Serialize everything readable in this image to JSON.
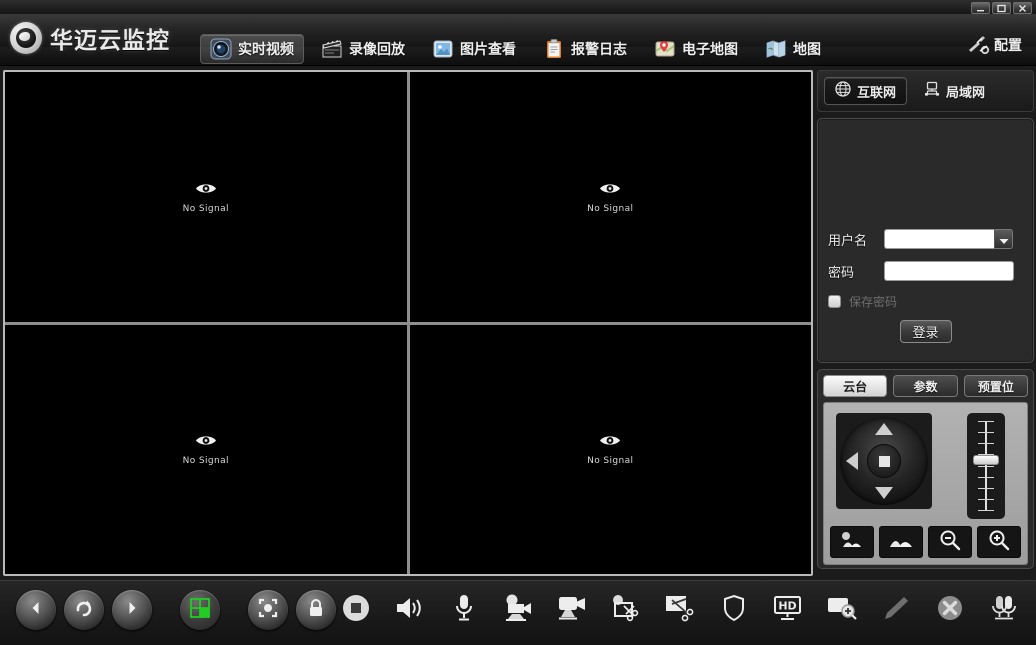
{
  "window": {
    "title": "华迈云监控",
    "controls": [
      {
        "name": "minimize",
        "glyph": "–"
      },
      {
        "name": "maximize",
        "glyph": "❐"
      },
      {
        "name": "close",
        "glyph": "✕"
      }
    ]
  },
  "header": {
    "logo_text": "华迈云监控",
    "nav": [
      {
        "label": "实时视频",
        "icon": "camera-lens-icon",
        "active": true
      },
      {
        "label": "录像回放",
        "icon": "clapperboard-icon",
        "active": false
      },
      {
        "label": "图片查看",
        "icon": "picture-icon",
        "active": false
      },
      {
        "label": "报警日志",
        "icon": "clipboard-icon",
        "active": false
      },
      {
        "label": "电子地图",
        "icon": "emap-pin-icon",
        "active": false
      },
      {
        "label": "地图",
        "icon": "folded-map-icon",
        "active": false
      }
    ],
    "config_label": "配置",
    "config_icon": "tools-icon"
  },
  "video": {
    "layout": "2x2",
    "cells": [
      {
        "status": "No Signal",
        "icon": "eye-icon"
      },
      {
        "status": "No Signal",
        "icon": "eye-icon"
      },
      {
        "status": "No Signal",
        "icon": "eye-icon"
      },
      {
        "status": "No Signal",
        "icon": "eye-icon"
      }
    ]
  },
  "right_panel": {
    "network_tabs": [
      {
        "label": "互联网",
        "icon": "globe-icon",
        "active": true
      },
      {
        "label": "局域网",
        "icon": "lan-icon",
        "active": false
      }
    ],
    "login": {
      "username_label": "用户名",
      "username_value": "",
      "username_placeholder": "",
      "password_label": "密码",
      "password_value": "",
      "password_placeholder": "",
      "save_password_label": "保存密码",
      "save_password_checked": false,
      "login_button": "登录",
      "dropdown_icon": "chevron-down-icon"
    },
    "ptz": {
      "tabs": [
        {
          "label": "云台",
          "active": true
        },
        {
          "label": "参数",
          "active": false
        },
        {
          "label": "预置位",
          "active": false
        }
      ],
      "dpad": {
        "up": "up-arrow-icon",
        "down": "down-arrow-icon",
        "left": "left-arrow-icon",
        "right": "right-arrow-icon",
        "center": "stop-square-icon"
      },
      "slider": {
        "name": "speed-slider",
        "value": 57
      },
      "buttons": [
        {
          "name": "iris-icon"
        },
        {
          "name": "focus-icon"
        },
        {
          "name": "zoom-out-icon"
        },
        {
          "name": "zoom-in-icon"
        }
      ]
    }
  },
  "toolbar": {
    "left": [
      {
        "name": "previous-page-button",
        "icon": "chevron-left-icon"
      },
      {
        "name": "auto-switch-button",
        "icon": "refresh-arrow-icon"
      },
      {
        "name": "next-page-button",
        "icon": "chevron-right-icon"
      },
      {
        "name": "layout-grid-button",
        "icon": "grid-2x2-icon",
        "accent": "#22cc22"
      },
      {
        "name": "fullscreen-button",
        "icon": "fullscreen-icon"
      },
      {
        "name": "lock-button",
        "icon": "lock-icon"
      }
    ],
    "main": [
      {
        "name": "stop-all-button",
        "icon": "stop-circle-icon"
      },
      {
        "name": "audio-button",
        "icon": "speaker-icon"
      },
      {
        "name": "talk-button",
        "icon": "microphone-icon"
      },
      {
        "name": "record-camera-button",
        "icon": "video-camera-record-icon"
      },
      {
        "name": "local-record-button",
        "icon": "monitor-camera-icon"
      },
      {
        "name": "snapshot-cut-button",
        "icon": "camera-scissors-icon"
      },
      {
        "name": "screen-cut-button",
        "icon": "monitor-scissors-icon"
      },
      {
        "name": "guard-button",
        "icon": "shield-icon"
      },
      {
        "name": "hd-stream-button",
        "icon": "hd-monitor-icon"
      },
      {
        "name": "digital-zoom-button",
        "icon": "screen-zoom-icon"
      },
      {
        "name": "draw-button",
        "icon": "pencil-icon"
      },
      {
        "name": "close-all-button",
        "icon": "close-circle-icon"
      },
      {
        "name": "multi-talk-button",
        "icon": "multi-microphone-icon"
      },
      {
        "name": "alarm-button",
        "icon": "warning-triangle-icon"
      }
    ]
  },
  "colors": {
    "accent_green": "#22cc22",
    "panel_bg": "#2a2a2a",
    "header_bg": "#1e1e1e",
    "text_primary": "#efefef",
    "text_disabled": "#6e6e6e"
  }
}
